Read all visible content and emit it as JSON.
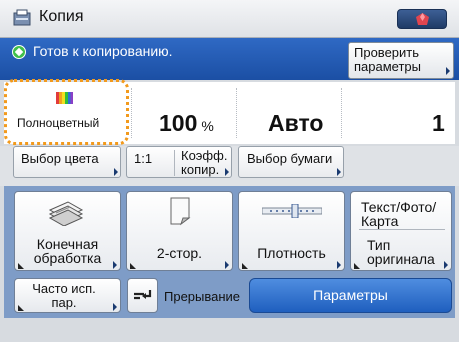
{
  "title": {
    "text": "Копия",
    "icon": "copy-app-icon"
  },
  "status": {
    "text": "Готов к копированию.",
    "icon": "ready-status-icon",
    "check_button": "Проверить параметры"
  },
  "settings": {
    "color_mode": "Полноцветный",
    "ratio_value": "100",
    "ratio_unit": "%",
    "paper": "Авто",
    "copies": "1"
  },
  "tabs": {
    "color_select": "Выбор цвета",
    "one_to_one": "1:1",
    "zoom_ratio": "Коэфф. копир.",
    "paper_select": "Выбор бумаги"
  },
  "functions": {
    "finishing": "Конечная обработка",
    "two_sided": "2-стор.",
    "density": "Плотность",
    "original_type_value": "Текст/Фото/ Карта",
    "original_type": "Тип оригинала"
  },
  "bottom": {
    "frequent": "Часто исп. пар.",
    "interrupt": "Прерывание",
    "options": "Параметры"
  },
  "colors": {
    "status_bar": "#2163c0",
    "highlight": "#f29a1d",
    "panel": "#7e9cc7",
    "options_button": "#2f72d2"
  }
}
